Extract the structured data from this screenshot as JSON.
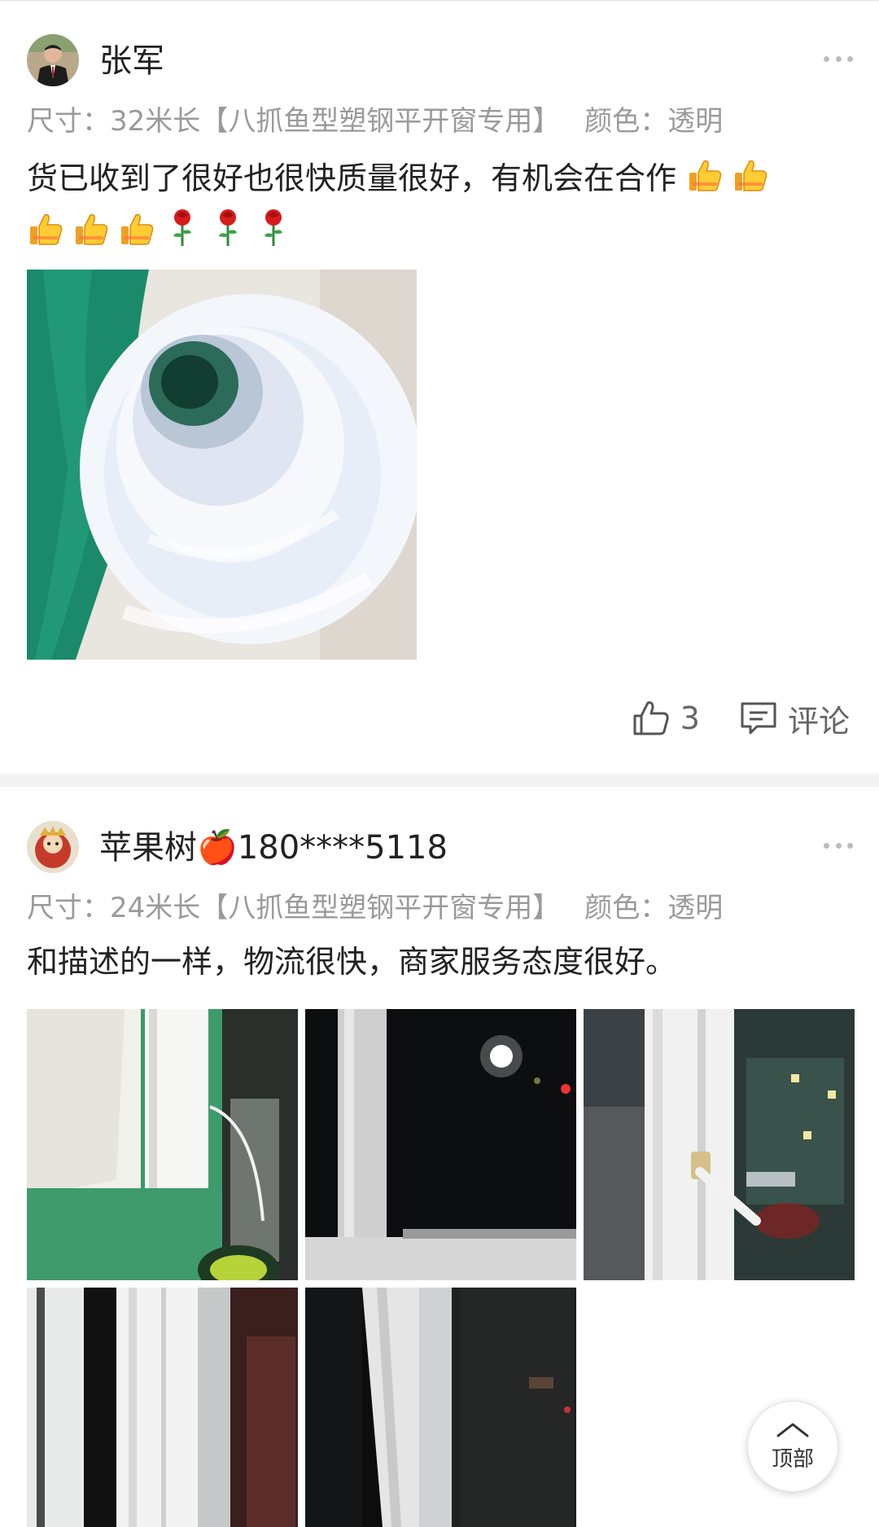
{
  "reviews": [
    {
      "username": "张军",
      "spec_size": "尺寸：32米长【八抓鱼型塑钢平开窗专用】",
      "spec_color": "颜色：透明",
      "content": "货已收到了很好也很快质量很好，有机会在合作",
      "emojis": [
        "thumbs-up",
        "thumbs-up",
        "thumbs-up",
        "thumbs-up",
        "thumbs-up",
        "rose",
        "rose",
        "rose"
      ],
      "likes": "3",
      "comment_label": "评论"
    },
    {
      "username": "苹果树🍎180****5118",
      "spec_size": "尺寸：24米长【八抓鱼型塑钢平开窗专用】",
      "spec_color": "颜色：透明",
      "content": "和描述的一样，物流很快，商家服务态度很好。"
    }
  ],
  "back_to_top_label": "顶部",
  "colors": {
    "accent_green": "#1a8a6a",
    "muted_text": "#9a9a9a",
    "divider": "#f3f3f3"
  }
}
